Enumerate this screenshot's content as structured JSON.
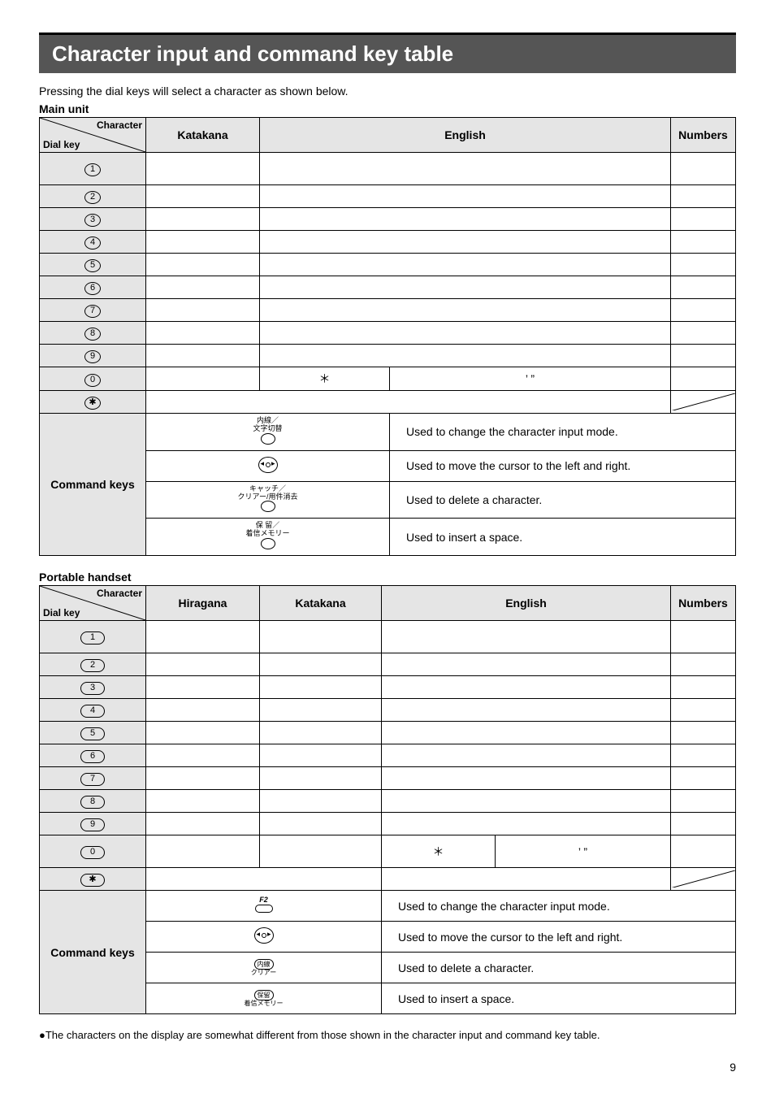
{
  "page": {
    "title": "Character input and command key table",
    "intro": "Pressing the dial keys will select a character as shown below.",
    "footnote": "●The characters on the display are somewhat different from those shown in the character input and command key table.",
    "page_number": "9"
  },
  "sections": {
    "main_unit": {
      "label": "Main unit",
      "header": {
        "diag_top": "Character",
        "diag_bottom": "Dial key",
        "katakana": "Katakana",
        "english": "English",
        "numbers": "Numbers"
      },
      "rows": [
        {
          "key": "1",
          "katakana": "",
          "english": "",
          "numbers": ""
        },
        {
          "key": "2",
          "katakana": "",
          "english": "",
          "numbers": ""
        },
        {
          "key": "3",
          "katakana": "",
          "english": "",
          "numbers": ""
        },
        {
          "key": "4",
          "katakana": "",
          "english": "",
          "numbers": ""
        },
        {
          "key": "5",
          "katakana": "",
          "english": "",
          "numbers": ""
        },
        {
          "key": "6",
          "katakana": "",
          "english": "",
          "numbers": ""
        },
        {
          "key": "7",
          "katakana": "",
          "english": "",
          "numbers": ""
        },
        {
          "key": "8",
          "katakana": "",
          "english": "",
          "numbers": ""
        },
        {
          "key": "9",
          "katakana": "",
          "english": "",
          "numbers": ""
        },
        {
          "key": "0",
          "katakana": "",
          "english_left": "＊",
          "english_right": "’  ”",
          "numbers": ""
        },
        {
          "key": "✱",
          "katakana": "",
          "english": "",
          "numbers": ""
        }
      ],
      "commands": {
        "label": "Command keys",
        "items": [
          {
            "key_top": "内線／",
            "key_mid": "文字切替",
            "desc": "Used to change the character input mode."
          },
          {
            "nav": true,
            "desc": "Used to move the cursor to the left and right."
          },
          {
            "key_top": "キャッチ／",
            "key_mid": "クリアー/用件消去",
            "desc": "Used to delete a character."
          },
          {
            "key_top": "保 留／",
            "key_mid": "着信メモリー",
            "desc": "Used to insert a space."
          }
        ]
      }
    },
    "portable": {
      "label": "Portable handset",
      "header": {
        "diag_top": "Character",
        "diag_bottom": "Dial key",
        "hiragana": "Hiragana",
        "katakana": "Katakana",
        "english": "English",
        "numbers": "Numbers"
      },
      "rows": [
        {
          "key": "1",
          "h": "",
          "k": "",
          "e": "",
          "n": ""
        },
        {
          "key": "2",
          "h": "",
          "k": "",
          "e": "",
          "n": ""
        },
        {
          "key": "3",
          "h": "",
          "k": "",
          "e": "",
          "n": ""
        },
        {
          "key": "4",
          "h": "",
          "k": "",
          "e": "",
          "n": ""
        },
        {
          "key": "5",
          "h": "",
          "k": "",
          "e": "",
          "n": ""
        },
        {
          "key": "6",
          "h": "",
          "k": "",
          "e": "",
          "n": ""
        },
        {
          "key": "7",
          "h": "",
          "k": "",
          "e": "",
          "n": ""
        },
        {
          "key": "8",
          "h": "",
          "k": "",
          "e": "",
          "n": ""
        },
        {
          "key": "9",
          "h": "",
          "k": "",
          "e": "",
          "n": ""
        },
        {
          "key": "0",
          "h": "",
          "k": "",
          "e_left": "＊",
          "e_right": "’  ”",
          "n": ""
        },
        {
          "key": "✱",
          "h": "",
          "k": "",
          "e": "",
          "n": ""
        }
      ],
      "commands": {
        "label": "Command keys",
        "items": [
          {
            "f2": true,
            "f2_label": "F2",
            "desc": "Used to change the character input mode."
          },
          {
            "nav": true,
            "desc": "Used to move the cursor to the left and right."
          },
          {
            "oval": "内線",
            "below": "クリアー",
            "desc": "Used to delete a character."
          },
          {
            "oval": "保留",
            "below": "着信メモリー",
            "desc": "Used to insert a space."
          }
        ]
      }
    }
  }
}
